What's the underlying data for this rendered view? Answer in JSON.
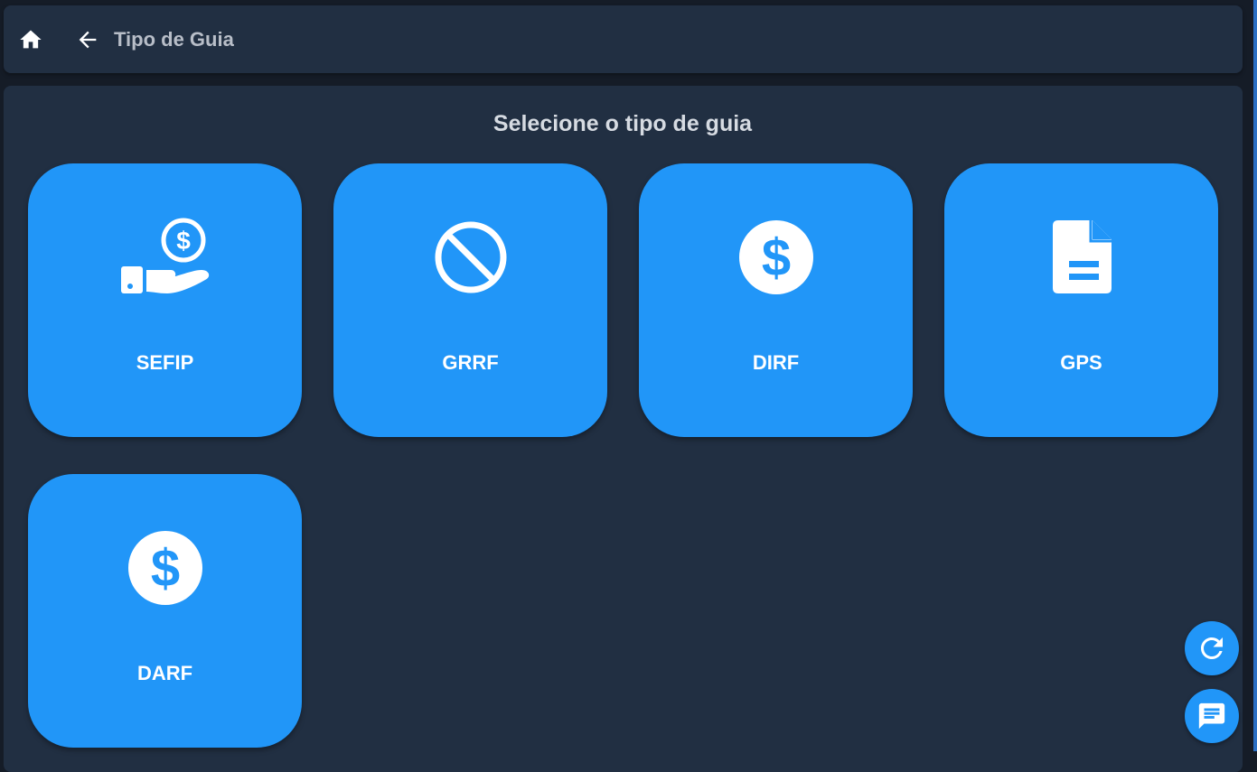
{
  "header": {
    "title": "Tipo de Guia",
    "home_icon": "home-icon",
    "back_icon": "arrow-left-icon"
  },
  "main": {
    "heading": "Selecione o tipo de guia",
    "cards": [
      {
        "label": "SEFIP",
        "icon": "hand-coin-icon"
      },
      {
        "label": "GRRF",
        "icon": "block-icon"
      },
      {
        "label": "DIRF",
        "icon": "dollar-circle-icon"
      },
      {
        "label": "GPS",
        "icon": "document-icon"
      },
      {
        "label": "DARF",
        "icon": "dollar-circle-icon"
      }
    ]
  },
  "fabs": {
    "refresh_icon": "refresh-icon",
    "chat_icon": "chat-icon"
  },
  "colors": {
    "background": "#151c27",
    "surface": "#212f42",
    "accent": "#2196f8",
    "card_text": "#ffffff",
    "header_text": "#b8bec8"
  }
}
